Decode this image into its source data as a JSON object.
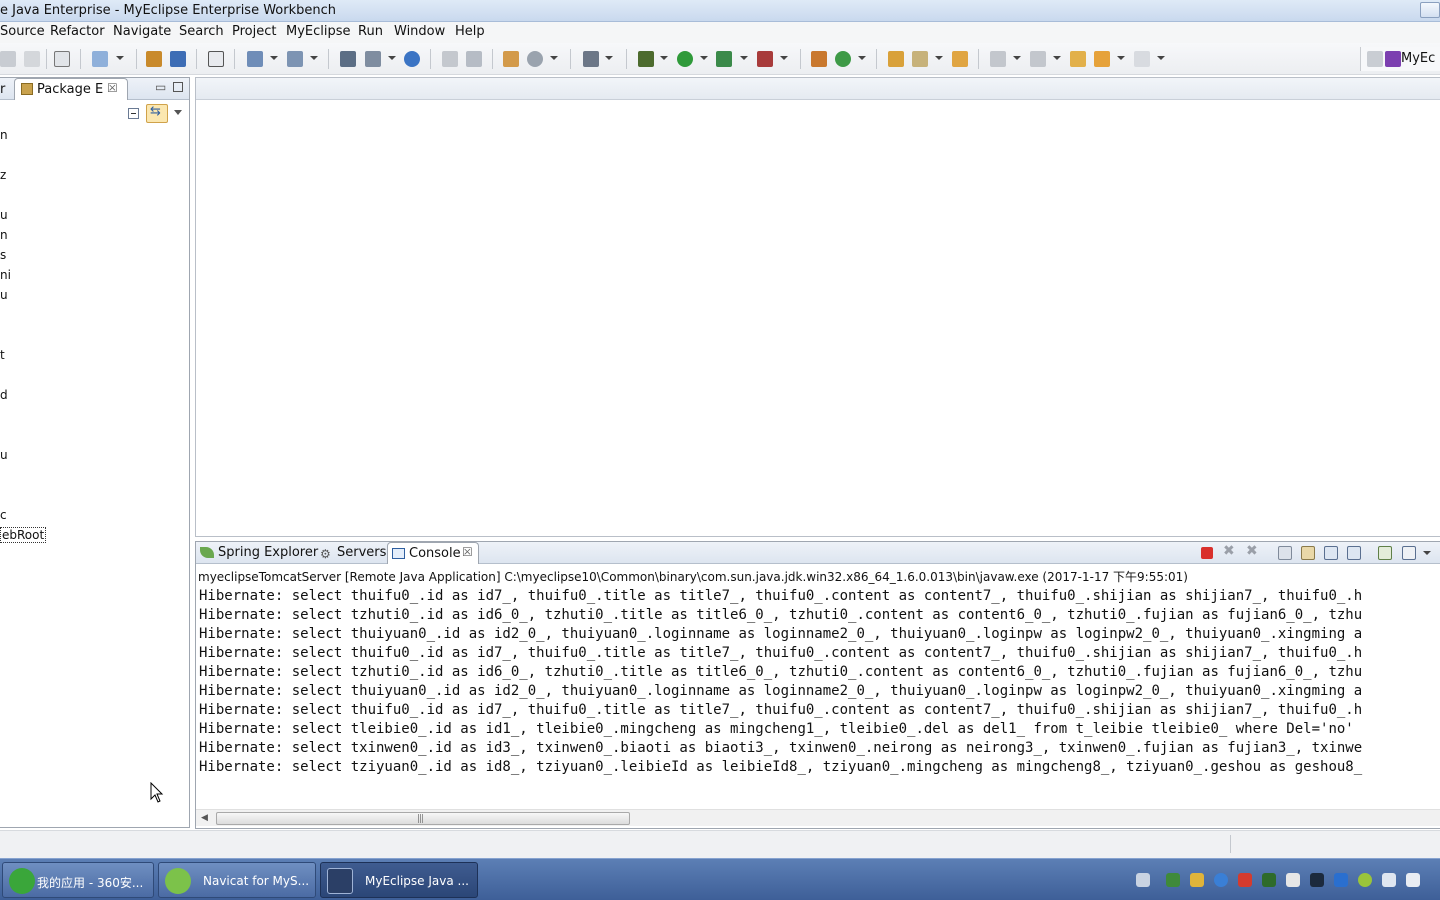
{
  "window": {
    "title": "e Java Enterprise - MyEclipse Enterprise Workbench"
  },
  "menu": [
    "Source",
    "Refactor",
    "Navigate",
    "Search",
    "Project",
    "MyEclipse",
    "Run",
    "Window",
    "Help"
  ],
  "perspective": {
    "label": "MyEc"
  },
  "left_panel": {
    "prev_tab": "r",
    "tab_label": "Package E",
    "tree_items": [
      "n",
      "z",
      "u",
      "n",
      "s",
      "ni",
      "u",
      "t",
      "d",
      "u",
      "c",
      "ebRoot"
    ]
  },
  "bottom_tabs": [
    {
      "label": "Spring Explorer"
    },
    {
      "label": "Servers"
    },
    {
      "label": "Console"
    }
  ],
  "console": {
    "description": "myeclipseTomcatServer [Remote Java Application] C:\\myeclipse10\\Common\\binary\\com.sun.java.jdk.win32.x86_64_1.6.0.013\\bin\\javaw.exe (2017-1-17 下午9:55:01)",
    "lines": [
      "Hibernate: select thuifu0_.id as id7_, thuifu0_.title as title7_, thuifu0_.content as content7_, thuifu0_.shijian as shijian7_, thuifu0_.h",
      "Hibernate: select tzhuti0_.id as id6_0_, tzhuti0_.title as title6_0_, tzhuti0_.content as content6_0_, tzhuti0_.fujian as fujian6_0_, tzhu",
      "Hibernate: select thuiyuan0_.id as id2_0_, thuiyuan0_.loginname as loginname2_0_, thuiyuan0_.loginpw as loginpw2_0_, thuiyuan0_.xingming a",
      "Hibernate: select thuifu0_.id as id7_, thuifu0_.title as title7_, thuifu0_.content as content7_, thuifu0_.shijian as shijian7_, thuifu0_.h",
      "Hibernate: select tzhuti0_.id as id6_0_, tzhuti0_.title as title6_0_, tzhuti0_.content as content6_0_, tzhuti0_.fujian as fujian6_0_, tzhu",
      "Hibernate: select thuiyuan0_.id as id2_0_, thuiyuan0_.loginname as loginname2_0_, thuiyuan0_.loginpw as loginpw2_0_, thuiyuan0_.xingming a",
      "Hibernate: select thuifu0_.id as id7_, thuifu0_.title as title7_, thuifu0_.content as content7_, thuifu0_.shijian as shijian7_, thuifu0_.h",
      "Hibernate: select tleibie0_.id as id1_, tleibie0_.mingcheng as mingcheng1_, tleibie0_.del as del1_ from t_leibie tleibie0_ where Del='no'",
      "Hibernate: select txinwen0_.id as id3_, txinwen0_.biaoti as biaoti3_, txinwen0_.neirong as neirong3_, txinwen0_.fujian as fujian3_, txinwe",
      "Hibernate: select tziyuan0_.id as id8_, tziyuan0_.leibieId as leibieId8_, tziyuan0_.mingcheng as mingcheng8_, tziyuan0_.geshou as geshou8_"
    ]
  },
  "taskbar": {
    "items": [
      {
        "label": "我的应用 - 360安...",
        "icon": "360-icon",
        "color": "#3aa63a"
      },
      {
        "label": "Navicat for MyS...",
        "icon": "navicat-icon",
        "color": "#7cc24a"
      },
      {
        "label": "MyEclipse Java ...",
        "icon": "myeclipse-icon",
        "color": "#2b3f66"
      }
    ]
  },
  "colors": {
    "stop_red": "#d9302c",
    "accent_blue": "#2f5fa0"
  }
}
